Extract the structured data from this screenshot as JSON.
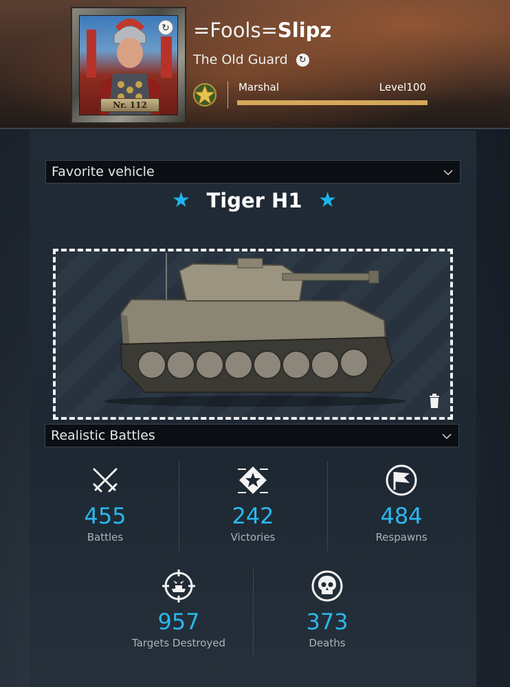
{
  "profile": {
    "nick_prefix": "=Fools=",
    "nick_name": "Slipz",
    "title": "The Old Guard",
    "rank": "Marshal",
    "level_label": "Level",
    "level_value": "100",
    "level_progress": 1.0,
    "avatar_plate": "Nr. 112"
  },
  "favorite": {
    "dropdown_label": "Favorite vehicle",
    "vehicle_name": "Tiger H1",
    "accent_color": "#1fb3ee"
  },
  "mode": {
    "dropdown_label": "Realistic Battles"
  },
  "stats": {
    "battles": {
      "value": "455",
      "label": "Battles"
    },
    "victories": {
      "value": "242",
      "label": "Victories"
    },
    "respawns": {
      "value": "484",
      "label": "Respawns"
    },
    "targets": {
      "value": "957",
      "label": "Targets Destroyed"
    },
    "deaths": {
      "value": "373",
      "label": "Deaths"
    }
  },
  "icons": {
    "avatar_change": "refresh-icon",
    "title_change": "refresh-icon",
    "rank": "rank-star-icon",
    "dropdown": "chevron-down-icon",
    "delete": "trash-icon",
    "battles": "crossed-swords-icon",
    "victories": "victory-star-icon",
    "respawns": "flag-icon",
    "targets": "crosshair-icon",
    "deaths": "skull-icon"
  }
}
